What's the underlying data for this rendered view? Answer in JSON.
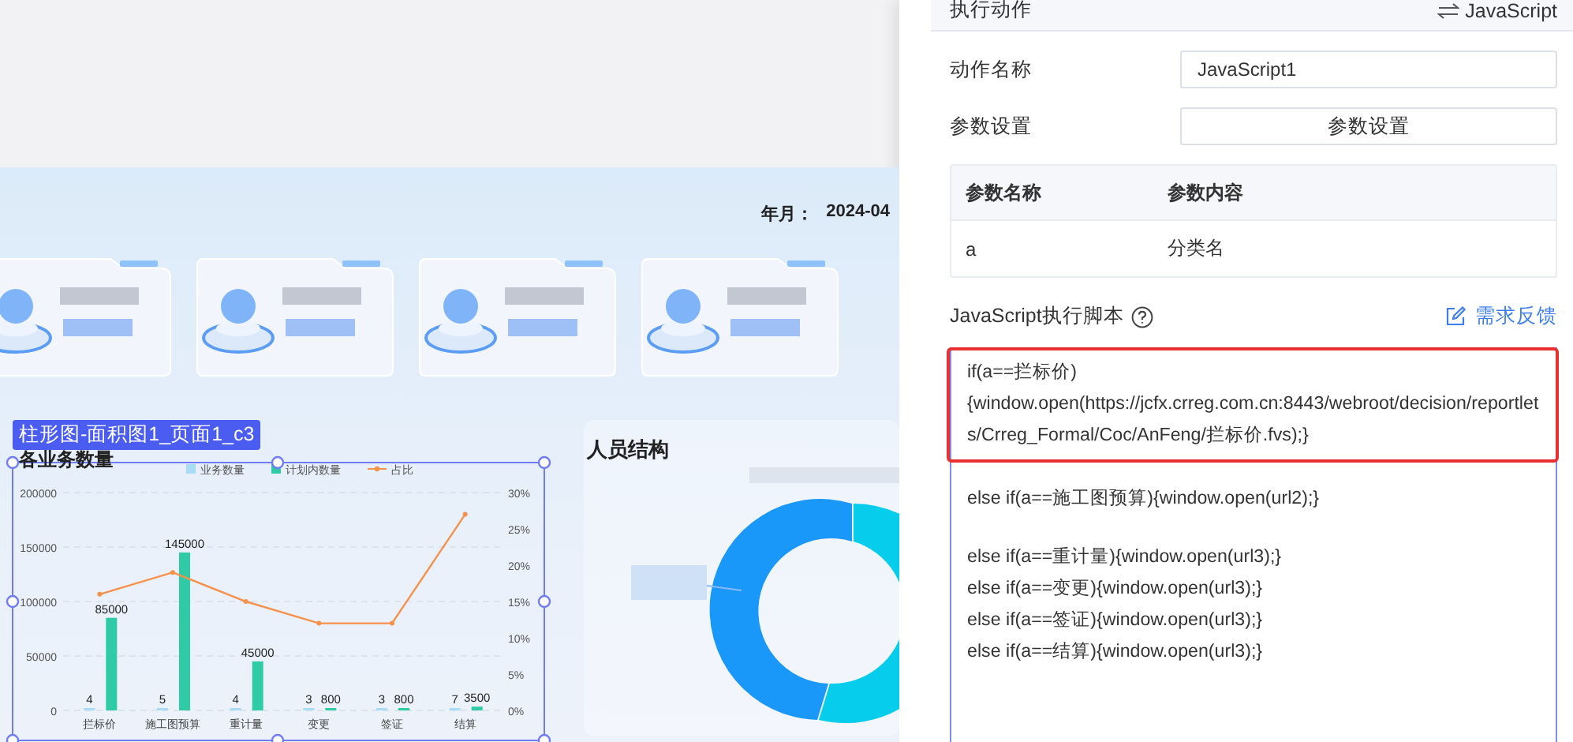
{
  "dashboard": {
    "date_label": "年月：",
    "date_value": "2024-04",
    "selection_badge": "柱形图-面积图1_页面1_c3",
    "chart_panel": {
      "chart_data": {
        "type": "bar",
        "title": "各业务数量",
        "categories": [
          "拦标价",
          "施工图预算",
          "重计量",
          "变更",
          "签证",
          "结算"
        ],
        "series": [
          {
            "name": "业务数量",
            "color": "#a8dcf5",
            "values": [
              4,
              5,
              4,
              3,
              3,
              7
            ],
            "value_labels": [
              "4",
              "5",
              "4",
              "3",
              "3",
              "7"
            ]
          },
          {
            "name": "计划内数量",
            "color": "#2ecba6",
            "values": [
              85000,
              145000,
              45000,
              800,
              800,
              3500
            ],
            "value_labels": [
              "85000",
              "145000",
              "45000",
              "800",
              "800",
              "3500"
            ]
          },
          {
            "name": "占比",
            "color": "#f5914a",
            "axis": "y2",
            "type": "line",
            "marker": "circle",
            "values": [
              16,
              19,
              15,
              12,
              12,
              27
            ]
          }
        ],
        "grid": true,
        "legend": "top",
        "ylim": [
          0,
          200000
        ],
        "yticks": [
          0,
          50000,
          100000,
          150000,
          200000
        ],
        "y2lim": [
          0,
          30
        ],
        "y2ticks": [
          {
            "value": 0,
            "label": "0%"
          },
          {
            "value": 5,
            "label": "5%"
          },
          {
            "value": 10,
            "label": "10%"
          },
          {
            "value": 15,
            "label": "15%"
          },
          {
            "value": 20,
            "label": "20%"
          },
          {
            "value": 25,
            "label": "25%"
          },
          {
            "value": 30,
            "label": "30%"
          }
        ],
        "orientation": "vertical"
      }
    },
    "people_panel": {
      "title": "人员结构"
    }
  },
  "action_panel": {
    "header": {
      "label": "执行动作",
      "type_label": "JavaScript"
    },
    "name_field": {
      "label": "动作名称",
      "value": "JavaScript1"
    },
    "params_row": {
      "label": "参数设置",
      "button": "参数设置"
    },
    "params_table": {
      "columns": [
        "参数名称",
        "参数内容"
      ],
      "rows": [
        [
          "a",
          "分类名"
        ]
      ]
    },
    "script_label": "JavaScript执行脚本",
    "feedback_link": "需求反馈",
    "script_blocks": [
      {
        "highlighted": true,
        "lines": [
          "if(a==拦标价)",
          "{window.open(https://jcfx.crreg.com.cn:8443/webroot/decision/reportlets/Crreg_Formal/Coc/AnFeng/拦标价.fvs);}"
        ]
      },
      {
        "highlighted": false,
        "lines": [
          "else if(a==施工图预算){window.open(url2);}"
        ]
      },
      {
        "highlighted": false,
        "lines": [
          "else if(a==重计量){window.open(url3);}",
          "else if(a==变更){window.open(url3);}",
          "else if(a==签证){window.open(url3);}",
          "else if(a==结算){window.open(url3);}"
        ]
      }
    ]
  }
}
